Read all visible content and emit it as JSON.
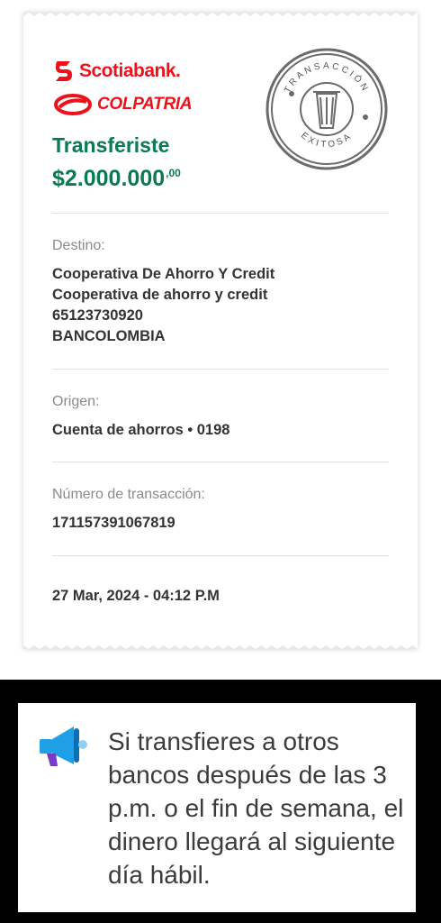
{
  "brand": {
    "scotiabank": "Scotiabank.",
    "colpatria": "COLPATRIA"
  },
  "stamp": {
    "top_text": "TRANSACCIÓN",
    "bottom_text": "EXITOSA",
    "icon": "trash-can-icon"
  },
  "receipt": {
    "headline": "Transferiste",
    "amount_main": "$2.000.000",
    "amount_cents": ",00",
    "destino": {
      "label": "Destino:",
      "line1": "Cooperativa De Ahorro Y Credit",
      "line2": "Cooperativa de ahorro y credit",
      "line3": "65123730920",
      "line4": "BANCOLOMBIA"
    },
    "origen": {
      "label": "Origen:",
      "value": "Cuenta de ahorros • 0198"
    },
    "transaccion": {
      "label": "Número de transacción:",
      "value": "171157391067819"
    },
    "datetime": "27 Mar, 2024 - 04:12 P.M"
  },
  "info": {
    "icon": "megaphone-icon",
    "message": "Si transfieres a otros bancos después de las 3 p.m. o el fin de semana, el dinero llegará al siguiente día hábil."
  },
  "colors": {
    "green": "#0a7a55",
    "red": "#ec111a",
    "megaphone_blue": "#1fa0e6",
    "megaphone_purple": "#7a3cc8"
  }
}
